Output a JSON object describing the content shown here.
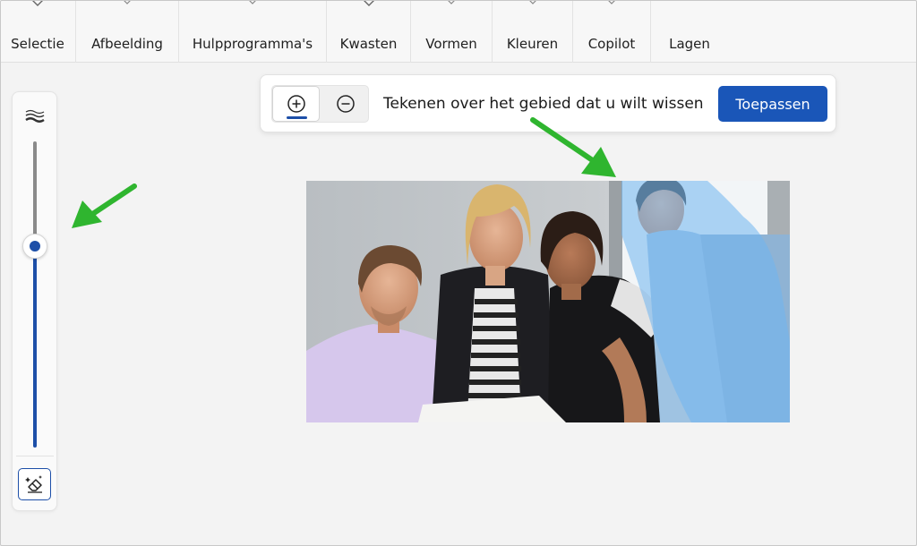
{
  "toolbar": {
    "items": [
      {
        "label": "Selectie",
        "chevron": "large"
      },
      {
        "label": "Afbeelding",
        "chevron": "small"
      },
      {
        "label": "Hulpprogramma's",
        "chevron": "small"
      },
      {
        "label": "Kwasten",
        "chevron": "large"
      },
      {
        "label": "Vormen",
        "chevron": "small"
      },
      {
        "label": "Kleuren",
        "chevron": "small"
      },
      {
        "label": "Copilot",
        "chevron": "small"
      },
      {
        "label": "Lagen",
        "chevron": "none"
      }
    ]
  },
  "brush_panel": {
    "size_icon": "brush-size-icon",
    "size_value_fraction": 0.66,
    "tool_icon": "magic-eraser-icon"
  },
  "action_bar": {
    "add_icon": "plus-circle-icon",
    "remove_icon": "minus-circle-icon",
    "instruction": "Tekenen over het gebied dat u wilt wissen",
    "apply_label": "Toepassen"
  },
  "colors": {
    "accent": "#1d4fa8",
    "apply_button": "#1a56b8",
    "annotation_arrow": "#2fb52f",
    "erase_mask": "#6fb4f0"
  }
}
